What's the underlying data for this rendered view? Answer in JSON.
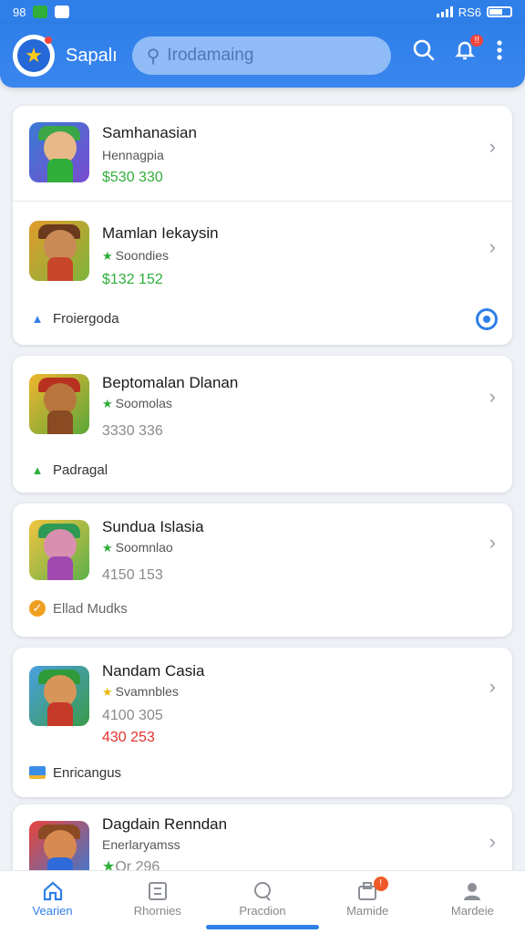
{
  "status_bar": {
    "time": "98",
    "right_text": "RS6"
  },
  "header": {
    "title": "Sapalı",
    "search_placeholder": "Irodamaing",
    "notification_badge": "!!"
  },
  "items": [
    {
      "title": "Samhanasian",
      "subtitle": "Hennagpia",
      "price": "$530 330",
      "price_color": "#2fae3a",
      "star": "none"
    },
    {
      "title": "Mamlan Iekaysin",
      "subtitle": "Soondies",
      "price": "$132 152",
      "price_color": "#8a8a8a",
      "star": "green",
      "footer": "Froiergoda",
      "footer_icon": "building-icon"
    },
    {
      "title": "Beptomalan Dlanan",
      "subtitle": "Soomolas",
      "price": "3330 336",
      "price_color": "#8a8a8a",
      "star": "green",
      "footer": "Padragal",
      "footer_icon": "mountain-icon"
    },
    {
      "title": "Sunduа Islasia",
      "subtitle": "Soomnlao",
      "price": "4150 153",
      "price_color": "#8a8a8a",
      "star": "green",
      "footer": "Ellad Mudks",
      "footer_icon": "badge-icon"
    },
    {
      "title": "Nandam Casia",
      "subtitle": "Svamnbles",
      "price": "4100 305",
      "price2": "430 253",
      "price_color": "#e3312e",
      "star": "yellow",
      "footer": "Enricangus",
      "footer_icon": "card-icon"
    },
    {
      "title": "Dagdain Renndan",
      "subtitle": "Enerlaryamss",
      "price": "Or 296",
      "price_color": "#8a8a8a",
      "star": "green"
    }
  ],
  "bottom_nav": [
    {
      "label": "Vearien",
      "icon": "home-icon",
      "active": true
    },
    {
      "label": "Rhornies",
      "icon": "grid-icon",
      "active": false
    },
    {
      "label": "Pracdion",
      "icon": "chat-icon",
      "active": false
    },
    {
      "label": "Mamide",
      "icon": "store-icon",
      "active": false,
      "badge": "!"
    },
    {
      "label": "Mardeie",
      "icon": "profile-icon",
      "active": false
    }
  ]
}
